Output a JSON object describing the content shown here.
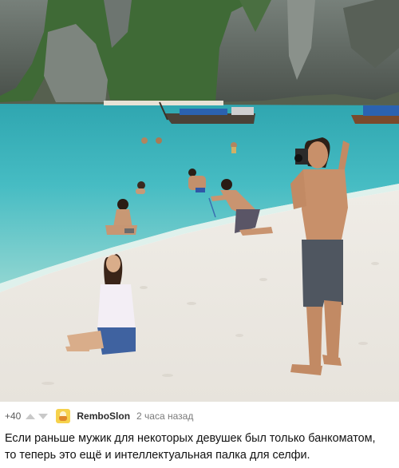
{
  "photo": {
    "alt_subject": "beach-photo"
  },
  "comment": {
    "score": "+40",
    "username": "RemboSlon",
    "time": "2 часа назад",
    "text_line1": "Если раньше мужик для некоторых девушек был только банкоматом,",
    "text_line2": "то теперь это ещё и интеллектуальная палка для селфи."
  },
  "colors": {
    "sand": "#eceae5",
    "water": "#4db8c0",
    "cliff": "#5f6660",
    "foliage": "#3e6b3a",
    "username": "#2b2b2b",
    "meta": "#7a7a7a"
  },
  "icons": {
    "upvote": "triangle-up-icon",
    "downvote": "triangle-down-icon",
    "avatar": "avatar-icon"
  }
}
